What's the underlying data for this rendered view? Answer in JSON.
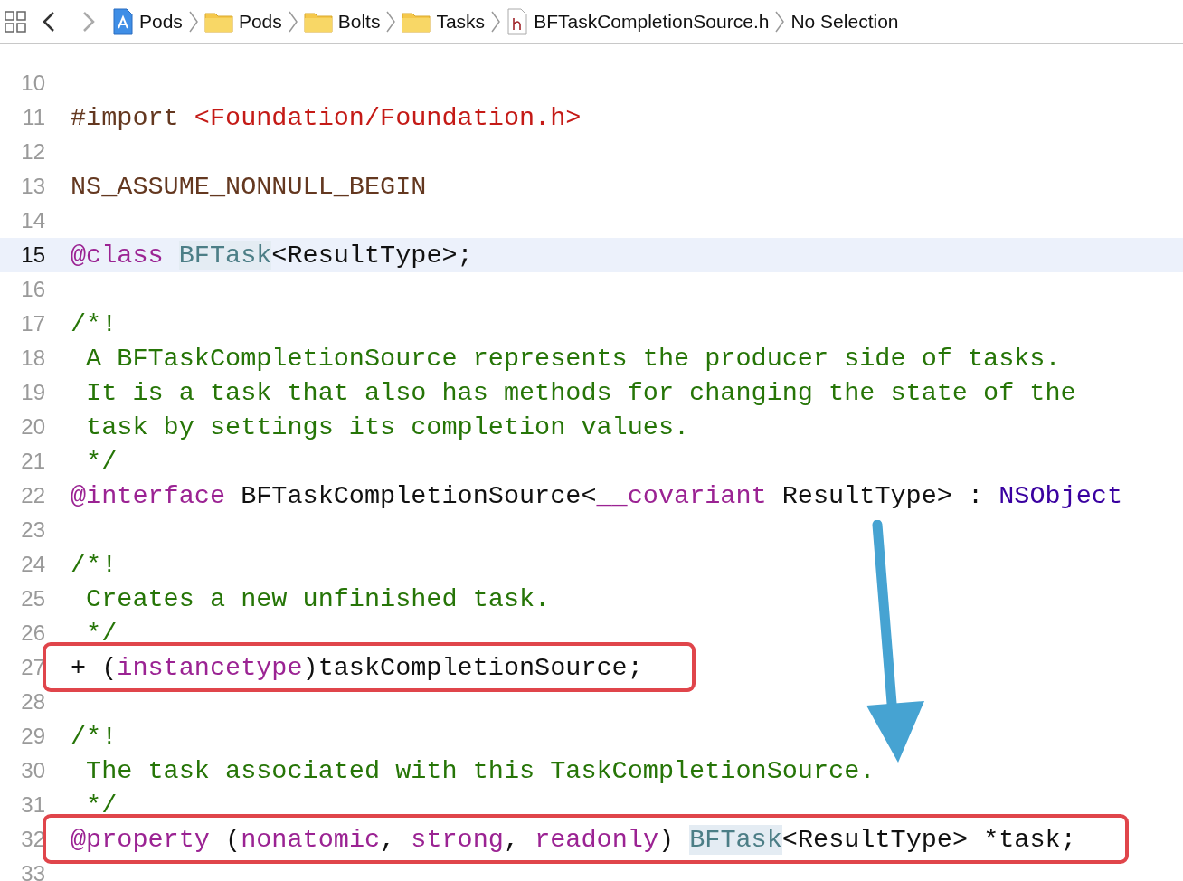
{
  "breadcrumb": {
    "items": [
      {
        "kind": "project",
        "label": "Pods"
      },
      {
        "kind": "folder",
        "label": "Pods"
      },
      {
        "kind": "folder",
        "label": "Bolts"
      },
      {
        "kind": "folder",
        "label": "Tasks"
      },
      {
        "kind": "header-file",
        "label": "BFTaskCompletionSource.h"
      },
      {
        "kind": "plain",
        "label": "No Selection"
      }
    ]
  },
  "editor": {
    "lines": [
      {
        "number": "10",
        "current": false,
        "boxed": false
      },
      {
        "number": "11",
        "current": false,
        "boxed": false,
        "tokens": [
          {
            "kind": "preprocessor",
            "text": "#import "
          },
          {
            "kind": "string",
            "text": "<Foundation/Foundation.h>"
          }
        ]
      },
      {
        "number": "12",
        "current": false,
        "boxed": false
      },
      {
        "number": "13",
        "current": false,
        "boxed": false,
        "tokens": [
          {
            "kind": "macro",
            "text": "NS_ASSUME_NONNULL_BEGIN"
          }
        ]
      },
      {
        "number": "14",
        "current": false,
        "boxed": false
      },
      {
        "number": "15",
        "current": true,
        "boxed": false,
        "tokens": [
          {
            "kind": "keyword",
            "text": "@class "
          },
          {
            "kind": "type",
            "text": "BFTask",
            "marked": true
          },
          {
            "kind": "plain",
            "text": "<ResultType>;"
          }
        ]
      },
      {
        "number": "16",
        "current": false,
        "boxed": false
      },
      {
        "number": "17",
        "current": false,
        "boxed": false,
        "tokens": [
          {
            "kind": "comment",
            "text": "/*!"
          }
        ]
      },
      {
        "number": "18",
        "current": false,
        "boxed": false,
        "tokens": [
          {
            "kind": "comment",
            "text": " A BFTaskCompletionSource represents the producer side of tasks."
          }
        ]
      },
      {
        "number": "19",
        "current": false,
        "boxed": false,
        "tokens": [
          {
            "kind": "comment",
            "text": " It is a task that also has methods for changing the state of the"
          }
        ]
      },
      {
        "number": "20",
        "current": false,
        "boxed": false,
        "tokens": [
          {
            "kind": "comment",
            "text": " task by settings its completion values."
          }
        ]
      },
      {
        "number": "21",
        "current": false,
        "boxed": false,
        "tokens": [
          {
            "kind": "comment",
            "text": " */"
          }
        ]
      },
      {
        "number": "22",
        "current": false,
        "boxed": false,
        "tokens": [
          {
            "kind": "keyword",
            "text": "@interface "
          },
          {
            "kind": "plain",
            "text": "BFTaskCompletionSource<"
          },
          {
            "kind": "keyword",
            "text": "__covariant"
          },
          {
            "kind": "plain",
            "text": " ResultType> : "
          },
          {
            "kind": "class",
            "text": "NSObject"
          }
        ]
      },
      {
        "number": "23",
        "current": false,
        "boxed": false
      },
      {
        "number": "24",
        "current": false,
        "boxed": false,
        "tokens": [
          {
            "kind": "comment",
            "text": "/*!"
          }
        ]
      },
      {
        "number": "25",
        "current": false,
        "boxed": false,
        "tokens": [
          {
            "kind": "comment",
            "text": " Creates a new unfinished task."
          }
        ]
      },
      {
        "number": "26",
        "current": false,
        "boxed": false,
        "tokens": [
          {
            "kind": "comment",
            "text": " */"
          }
        ]
      },
      {
        "number": "27",
        "current": false,
        "boxed": true,
        "tokens": [
          {
            "kind": "plain",
            "text": "+ ("
          },
          {
            "kind": "keyword",
            "text": "instancetype"
          },
          {
            "kind": "plain",
            "text": ")taskCompletionSource;"
          }
        ]
      },
      {
        "number": "28",
        "current": false,
        "boxed": false
      },
      {
        "number": "29",
        "current": false,
        "boxed": false,
        "tokens": [
          {
            "kind": "comment",
            "text": "/*!"
          }
        ]
      },
      {
        "number": "30",
        "current": false,
        "boxed": false,
        "tokens": [
          {
            "kind": "comment",
            "text": " The task associated with this TaskCompletionSource."
          }
        ]
      },
      {
        "number": "31",
        "current": false,
        "boxed": false,
        "tokens": [
          {
            "kind": "comment",
            "text": " */"
          }
        ]
      },
      {
        "number": "32",
        "current": false,
        "boxed": true,
        "tokens": [
          {
            "kind": "keyword",
            "text": "@property"
          },
          {
            "kind": "plain",
            "text": " ("
          },
          {
            "kind": "keyword",
            "text": "nonatomic"
          },
          {
            "kind": "plain",
            "text": ", "
          },
          {
            "kind": "keyword",
            "text": "strong"
          },
          {
            "kind": "plain",
            "text": ", "
          },
          {
            "kind": "keyword",
            "text": "readonly"
          },
          {
            "kind": "plain",
            "text": ") "
          },
          {
            "kind": "type",
            "text": "BFTask",
            "marked": true
          },
          {
            "kind": "plain",
            "text": "<ResultType> *task;"
          }
        ]
      },
      {
        "number": "33",
        "current": false,
        "boxed": false
      }
    ]
  }
}
